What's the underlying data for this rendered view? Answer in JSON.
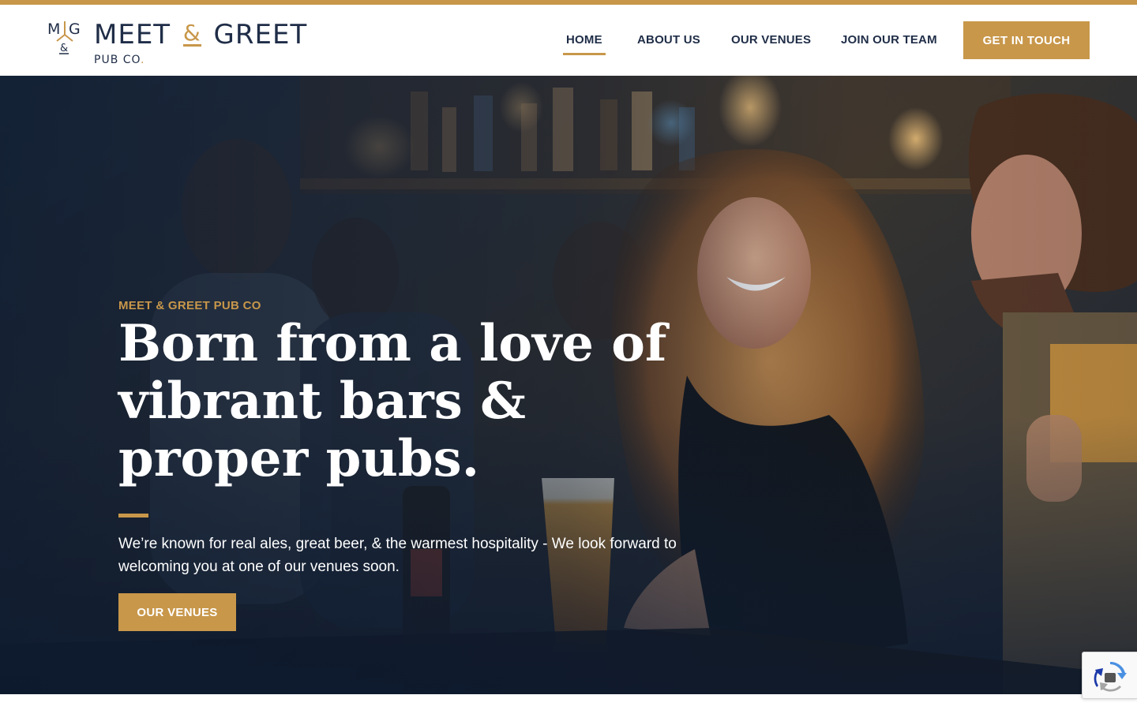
{
  "brand": {
    "monogram_left": "M",
    "monogram_right": "G",
    "monogram_amp": "&",
    "name_part1": "MEET",
    "name_amp": "&",
    "name_part2": "GREET",
    "sub": "PUB CO",
    "sub_dot": ".",
    "accent_color": "#c8974a",
    "navy_color": "#1f2d47"
  },
  "nav": {
    "items": [
      {
        "label": "HOME",
        "active": true
      },
      {
        "label": "ABOUT US",
        "active": false
      },
      {
        "label": "OUR VENUES",
        "active": false
      },
      {
        "label": "JOIN OUR TEAM",
        "active": false
      }
    ],
    "cta_label": "GET IN TOUCH"
  },
  "hero": {
    "eyebrow": "MEET & GREET PUB CO",
    "headline": "Born from a love of vibrant bars & proper pubs.",
    "lede": "We’re known for real ales, great beer, & the warmest hospitality - We look forward to welcoming you at one of our venues soon.",
    "button_label": "OUR VENUES",
    "image_subject": "friends laughing at a pub bar with pints of beer"
  },
  "recaptcha": {
    "icon": "recaptcha-icon"
  }
}
